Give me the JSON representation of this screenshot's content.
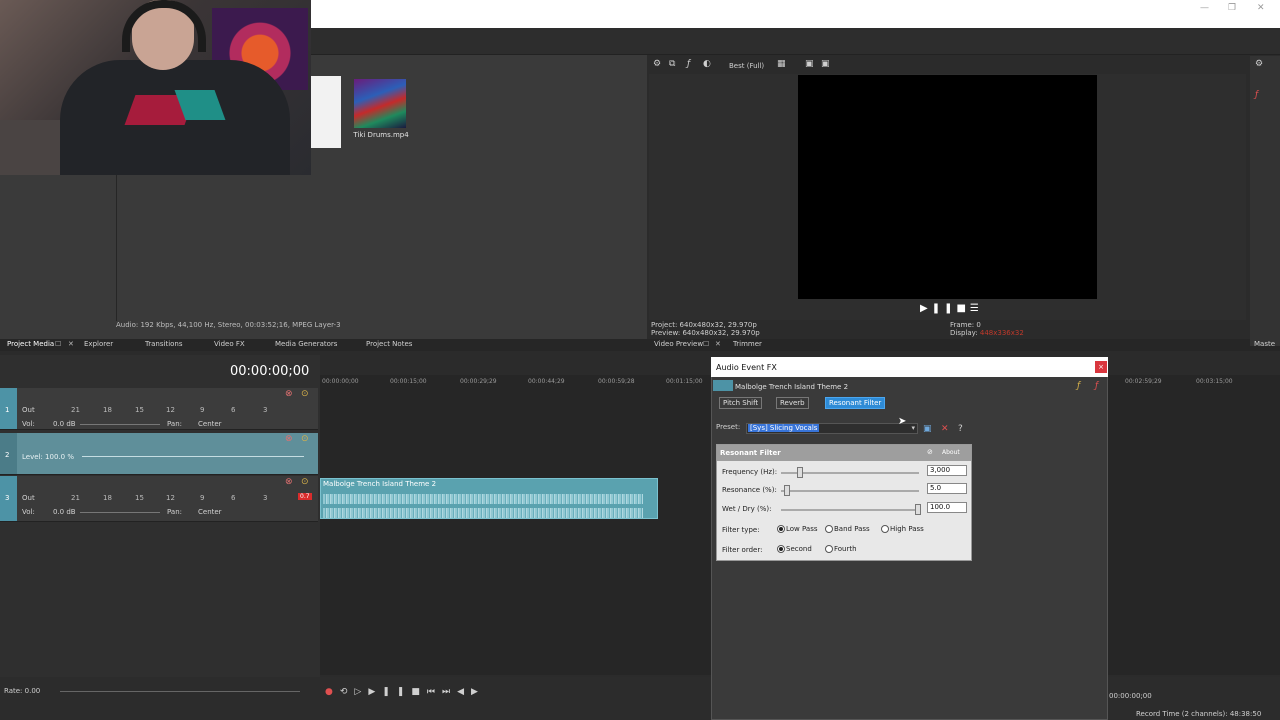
{
  "window": {
    "minimize": "—",
    "restore": "❐",
    "close": "✕"
  },
  "media": {
    "thumb_label": "Tiki Drums.mp4",
    "audio_status": "Audio: 192 Kbps, 44,100 Hz, Stereo, 00:03:52;16, MPEG Layer-3"
  },
  "tabs": [
    "Project Media",
    "Explorer",
    "Transitions",
    "Video FX",
    "Media Generators",
    "Project Notes"
  ],
  "preview": {
    "quality": "Best (Full)",
    "project": "Project:  640x480x32, 29.970p",
    "preview_res": "Preview:  640x480x32, 29.970p",
    "frame_label": "Frame:",
    "frame_value": "0",
    "display_label": "Display:",
    "display_value": "448x336x32",
    "tabs": [
      "Video Preview",
      "Trimmer"
    ],
    "right_tab": "Maste"
  },
  "timeline": {
    "timecode": "00:00:00;00",
    "ruler": [
      "00:00:00;00",
      "00:00:15;00",
      "00:00:29;29",
      "00:00:44;29",
      "00:00:59;28",
      "00:01:15;00",
      "00:02:59;29",
      "00:03:15;00"
    ],
    "track1": {
      "num": "1",
      "out": "Out",
      "vol_label": "Vol:",
      "vol": "0.0 dB",
      "pan_label": "Pan:",
      "pan": "Center",
      "ticks": [
        "21",
        "18",
        "15",
        "12",
        "9",
        "6",
        "3"
      ]
    },
    "track2": {
      "num": "2",
      "level": "Level: 100.0 %"
    },
    "track3": {
      "num": "3",
      "out": "Out",
      "vol_label": "Vol:",
      "vol": "0.0 dB",
      "pan_label": "Pan:",
      "pan": "Center",
      "peak": "0.7",
      "ticks": [
        "21",
        "18",
        "15",
        "12",
        "9",
        "6",
        "3"
      ]
    },
    "clip_label": "Malbolge Trench Island Theme 2",
    "rate": "Rate: 0.00",
    "end_timecode": "00:00:00;00",
    "record_time": "Record Time (2 channels): 48:38:50"
  },
  "dialog": {
    "title": "Audio Event FX",
    "close": "×",
    "event_name": "Malbolge Trench Island Theme 2",
    "chain": [
      "Pitch Shift",
      "Reverb",
      "Resonant Filter"
    ],
    "preset_label": "Preset:",
    "preset_value": "[Sys] Slicing Vocals",
    "plugin": {
      "title": "Resonant Filter",
      "about": "About",
      "frequency_label": "Frequency (Hz):",
      "frequency": "3,000",
      "resonance_label": "Resonance (%):",
      "resonance": "5.0",
      "wetdry_label": "Wet / Dry (%):",
      "wetdry": "100.0",
      "filter_type_label": "Filter type:",
      "filter_types": [
        "Low Pass",
        "Band Pass",
        "High Pass"
      ],
      "filter_order_label": "Filter order:",
      "filter_orders": [
        "Second",
        "Fourth"
      ]
    }
  }
}
